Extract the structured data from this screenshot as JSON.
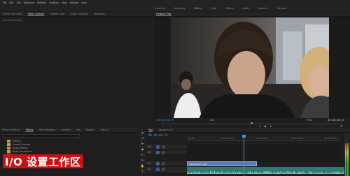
{
  "menu": [
    "File",
    "Edit",
    "Clip",
    "Sequence",
    "Markers",
    "Graphics",
    "View",
    "Window",
    "Help"
  ],
  "workspaces": [
    "Learning",
    "Assembly",
    "Editing",
    "Color",
    "Effects",
    "Audio",
    "Graphics",
    "Libraries"
  ],
  "workspace_active": 2,
  "source_panel": {
    "tabs": [
      "Source: (no clips)",
      "Effect Controls",
      "Lumetri Color",
      "Audio Clip Mixer",
      "Metadata"
    ],
    "active_tab": 1,
    "message": "(no clip selected)"
  },
  "program_panel": {
    "tab": "Program: Test",
    "timecode_current": "00;00;04;15",
    "fit": "Fit",
    "quality": "Full",
    "timecode_duration": "00;00;08;24"
  },
  "project_panel": {
    "tabs": [
      "Project: Untitled",
      "Effects",
      "Media Browser",
      "Libraries",
      "Info",
      "Markers",
      "History"
    ],
    "active_tab": 1,
    "items": [
      "Presets",
      "Lumetri Presets",
      "Audio Effects",
      "Audio Transitions",
      "Video Effects",
      "Video Transitions"
    ]
  },
  "caption": "I/O 设置工作区",
  "timeline": {
    "tabs": [
      "Test",
      "Sequence 01"
    ],
    "timecode": "00;00;04;15",
    "ruler": [
      "00;00",
      "00;00;02;00",
      "00;00;04;00",
      "00;00;06;00",
      "00;00;08;00"
    ],
    "tracks": [
      "V3",
      "V2",
      "V1",
      "A1",
      "A2"
    ],
    "video_clip_label": "Adjustment Layer"
  },
  "colors": {
    "accent": "#3f93d6",
    "caption_bg": "#c91313",
    "video_clip": "#5d79b8",
    "audio_clip": "#2f7b74"
  }
}
